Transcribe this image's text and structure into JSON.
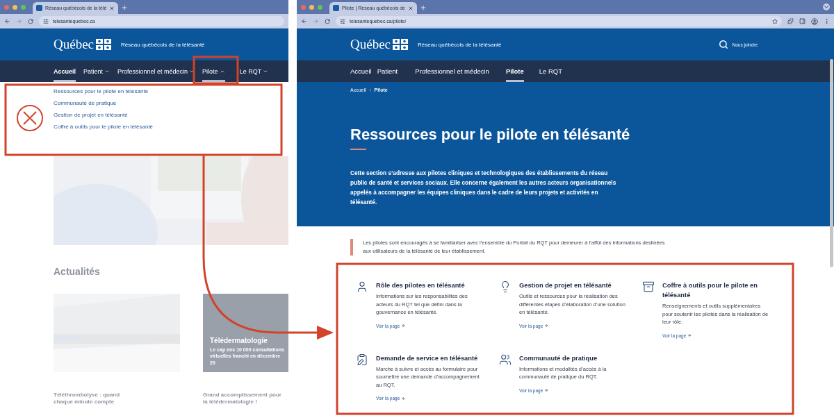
{
  "left_window": {
    "tab_title": "Réseau québécois de la télé",
    "url": "telesantequebec.ca",
    "logo": "Québec",
    "site_name": "Réseau québécois de la télésanté",
    "nav": [
      {
        "label": "Accueil",
        "kind": "link",
        "selected": true
      },
      {
        "label": "Patient",
        "kind": "menu",
        "selected": false,
        "expanded": false
      },
      {
        "label": "Professionnel et médecin",
        "kind": "menu",
        "selected": false,
        "expanded": false
      },
      {
        "label": "Pilote",
        "kind": "menu",
        "selected": false,
        "expanded": true
      },
      {
        "label": "Le RQT",
        "kind": "menu",
        "selected": false,
        "expanded": false
      }
    ],
    "dropdown": [
      "Ressources pour le pilote en télésanté",
      "Communauté de pratique",
      "Gestion de projet en télésanté",
      "Coffre à outils pour le pilote en télésanté"
    ],
    "news_heading": "Actualités",
    "feature_card": {
      "title": "Télédermatologie",
      "text": "Le cap des 10 000 consultations virtuelles franchi en décembre 20"
    },
    "news": [
      {
        "title": "Téléthrombolyse : quand chaque minute compte"
      },
      {
        "title": "Grand accomplissement pour la télédermatologie !"
      }
    ]
  },
  "right_window": {
    "tab_title": "Pilote | Réseau québécois de",
    "url": "telesantequebec.ca/pilote/",
    "logo": "Québec",
    "site_name": "Réseau québécois de la télésanté",
    "contact": "Nous joindre",
    "nav": [
      {
        "label": "Accueil",
        "selected": false
      },
      {
        "label": "Patient",
        "selected": false
      },
      {
        "label": "Professionnel et médecin",
        "selected": false
      },
      {
        "label": "Pilote",
        "selected": true
      },
      {
        "label": "Le RQT",
        "selected": false
      }
    ],
    "breadcrumb": [
      "Accueil",
      "Pilote"
    ],
    "title": "Ressources pour le pilote en télésanté",
    "intro": "Cette section s’adresse aux pilotes cliniques et technologiques des établissements du réseau public de santé et services sociaux. Elle concerne également les autres acteurs organisationnels appelés à accompagner les équipes cliniques dans le cadre de leurs projets et activités en télésanté.",
    "callout": "Les pilotes sont encouragés à se familiariser avec l’ensemble du Portail du RQT pour demeurer à l’affût des informations destinées aux utilisateurs de la télésanté de leur établissement.",
    "cards": [
      {
        "kind": "person",
        "title": "Rôle des pilotes en télésanté",
        "text": "Informations sur les responsabilités des acteurs du RQT tel que défini dans la gouvernance en télésanté.",
        "link": "Voir la page"
      },
      {
        "kind": "lightbulb",
        "title": "Gestion de projet en télésanté",
        "text": "Outils et ressources pour la réalisation des différentes étapes d’élaboration d’une solution en télésanté.",
        "link": "Voir la page"
      },
      {
        "kind": "toolbox",
        "title": "Coffre à outils pour le pilote en télésanté",
        "text": "Renseignements et outils supplémentaires pour soutenir les pilotes dans la réalisation de leur rôle.",
        "link": "Voir la page"
      },
      {
        "kind": "clipboard",
        "title": "Demande de service en télésanté",
        "text": "Marche à suivre et accès au formulaire pour soumettre une demande d’accompagnement au RQT.",
        "link": "Voir la page"
      },
      {
        "kind": "community",
        "title": "Communauté de pratique",
        "text": "Informations et modalités d’accès à la communauté de pratique du RQT.",
        "link": "Voir la page"
      }
    ]
  }
}
